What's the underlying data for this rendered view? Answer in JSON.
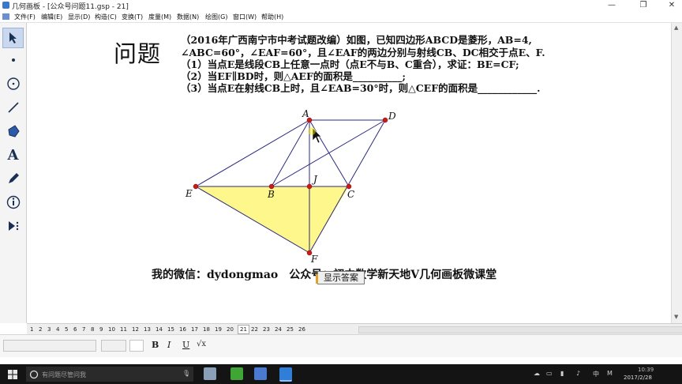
{
  "window": {
    "title": "几何画板 - [公众号问题11.gsp - 21]",
    "minimize": "—",
    "restore": "❐",
    "close": "✕"
  },
  "menubar": {
    "items": [
      "文件(F)",
      "编辑(E)",
      "显示(D)",
      "构造(C)",
      "变换(T)",
      "度量(M)",
      "数据(N)",
      "绘图(G)",
      "窗口(W)",
      "帮助(H)"
    ]
  },
  "toolbar": {
    "tools": [
      "selection-arrow",
      "point",
      "compass",
      "straightedge",
      "polygon",
      "text",
      "marker",
      "information",
      "custom-tools"
    ]
  },
  "problem": {
    "heading": "问题",
    "line1": "（2016年广西南宁市中考试题改编）如图，已知四边形ABCD是菱形，AB=4,",
    "line2": "∠ABC=60°，∠EAF=60°，且∠EAF的两边分别与射线CB、DC相交于点E、F.",
    "line3": "（1）当点E是线段CB上任意一点时（点E不与B、C重合），求证：BE=CF;",
    "line4": "（2）当EF∥BD时，则△AEF的面积是__________;",
    "line5": "（3）当点E在射线CB上时，且∠EAB=30°时，则△CEF的面积是____________."
  },
  "diagram": {
    "labels": {
      "A": "A",
      "D": "D",
      "J": "J",
      "E": "E",
      "B": "B",
      "C": "C",
      "F": "F"
    },
    "fill_color": "#fef78c",
    "line_color": "#2a2a80",
    "point_color": "#d01818"
  },
  "footer": {
    "wechat": "我的微信：dydongmao　公众号：初中数学新天地V几何画板微课堂",
    "answer_button": "显示答案"
  },
  "pages": {
    "tabs": [
      "1",
      "2",
      "3",
      "4",
      "5",
      "6",
      "7",
      "8",
      "9",
      "10",
      "11",
      "12",
      "13",
      "14",
      "15",
      "16",
      "17",
      "18",
      "19",
      "20",
      "21",
      "22",
      "23",
      "24",
      "25",
      "26"
    ],
    "active": "21"
  },
  "format": {
    "bold": "B",
    "italic": "I",
    "underline": "U"
  },
  "taskbar": {
    "search_placeholder": "有问题尽管问我",
    "ime": "中",
    "ime2": "M",
    "time": "10:39",
    "date": "2017/2/28"
  }
}
